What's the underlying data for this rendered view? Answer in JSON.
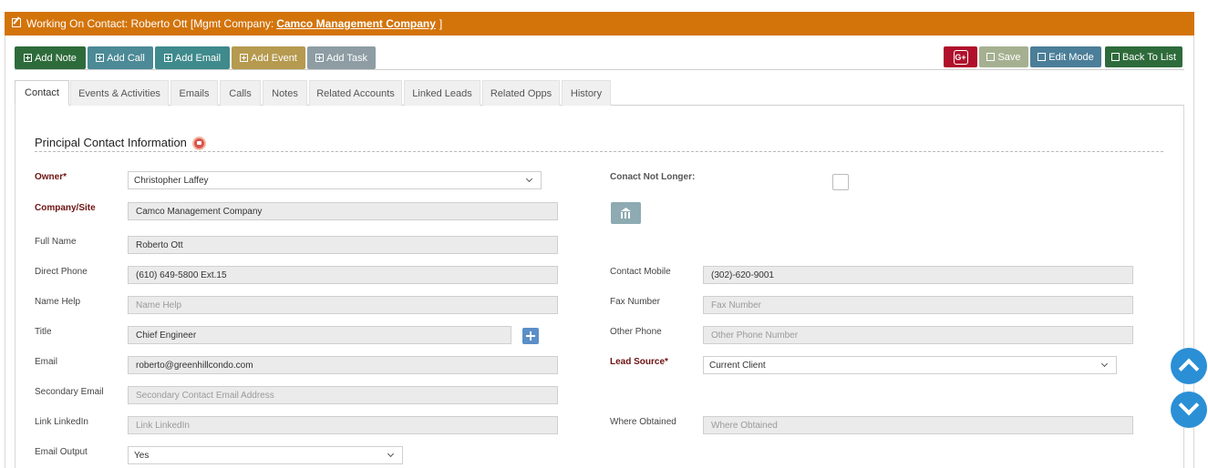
{
  "header": {
    "prefix": "Working On Contact: Roberto Ott [Mgmt Company:",
    "company_link": "Camco Management Company",
    "suffix": "]"
  },
  "actions": {
    "add_note": "Add Note",
    "add_call": "Add Call",
    "add_email": "Add Email",
    "add_event": "Add Event",
    "add_task": "Add Task",
    "gplus": "G+",
    "save": "Save",
    "edit_mode": "Edit Mode",
    "back_to_list": "Back To List"
  },
  "tabs": [
    {
      "label": "Contact",
      "active": true
    },
    {
      "label": "Events & Activities"
    },
    {
      "label": "Emails"
    },
    {
      "label": "Calls"
    },
    {
      "label": "Notes"
    },
    {
      "label": "Related Accounts"
    },
    {
      "label": "Linked Leads"
    },
    {
      "label": "Related Opps"
    },
    {
      "label": "History"
    }
  ],
  "section": {
    "title": "Principal Contact Information"
  },
  "left_fields": {
    "owner": {
      "label": "Owner*",
      "value": "Christopher Laffey"
    },
    "company": {
      "label": "Company/Site",
      "value": "Camco Management Company"
    },
    "full_name": {
      "label": "Full Name",
      "value": "Roberto Ott"
    },
    "direct_phone": {
      "label": "Direct Phone",
      "value": "(610) 649-5800 Ext.15"
    },
    "name_help": {
      "label": "Name Help",
      "placeholder": "Name Help"
    },
    "title": {
      "label": "Title",
      "value": "Chief Engineer"
    },
    "email": {
      "label": "Email",
      "value": "roberto@greenhillcondo.com"
    },
    "secondary_email": {
      "label": "Secondary Email",
      "placeholder": "Secondary Contact Email Address"
    },
    "linkedin": {
      "label": "Link LinkedIn",
      "placeholder": "Link LinkedIn"
    },
    "email_output": {
      "label": "Email Output",
      "value": "Yes"
    }
  },
  "right_fields": {
    "not_longer": {
      "label": "Conact Not Longer:"
    },
    "contact_mobile": {
      "label": "Contact Mobile",
      "value": "(302)-620-9001"
    },
    "fax": {
      "label": "Fax Number",
      "placeholder": "Fax Number"
    },
    "other_phone": {
      "label": "Other Phone",
      "placeholder": "Other Phone Number"
    },
    "lead_source": {
      "label": "Lead Source*",
      "value": "Current Client"
    },
    "where_obtained": {
      "label": "Where Obtained",
      "placeholder": "Where Obtained"
    }
  },
  "colors": {
    "header": "#d3740b",
    "required_label": "#6e1212",
    "scroll_button": "#2b8fd6"
  }
}
